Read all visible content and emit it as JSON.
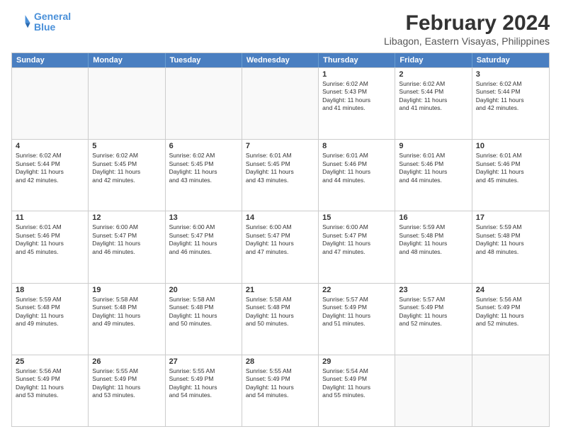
{
  "logo": {
    "line1": "General",
    "line2": "Blue"
  },
  "title": "February 2024",
  "subtitle": "Libagon, Eastern Visayas, Philippines",
  "header_days": [
    "Sunday",
    "Monday",
    "Tuesday",
    "Wednesday",
    "Thursday",
    "Friday",
    "Saturday"
  ],
  "rows": [
    [
      {
        "day": "",
        "info": ""
      },
      {
        "day": "",
        "info": ""
      },
      {
        "day": "",
        "info": ""
      },
      {
        "day": "",
        "info": ""
      },
      {
        "day": "1",
        "info": "Sunrise: 6:02 AM\nSunset: 5:43 PM\nDaylight: 11 hours\nand 41 minutes."
      },
      {
        "day": "2",
        "info": "Sunrise: 6:02 AM\nSunset: 5:44 PM\nDaylight: 11 hours\nand 41 minutes."
      },
      {
        "day": "3",
        "info": "Sunrise: 6:02 AM\nSunset: 5:44 PM\nDaylight: 11 hours\nand 42 minutes."
      }
    ],
    [
      {
        "day": "4",
        "info": "Sunrise: 6:02 AM\nSunset: 5:44 PM\nDaylight: 11 hours\nand 42 minutes."
      },
      {
        "day": "5",
        "info": "Sunrise: 6:02 AM\nSunset: 5:45 PM\nDaylight: 11 hours\nand 42 minutes."
      },
      {
        "day": "6",
        "info": "Sunrise: 6:02 AM\nSunset: 5:45 PM\nDaylight: 11 hours\nand 43 minutes."
      },
      {
        "day": "7",
        "info": "Sunrise: 6:01 AM\nSunset: 5:45 PM\nDaylight: 11 hours\nand 43 minutes."
      },
      {
        "day": "8",
        "info": "Sunrise: 6:01 AM\nSunset: 5:46 PM\nDaylight: 11 hours\nand 44 minutes."
      },
      {
        "day": "9",
        "info": "Sunrise: 6:01 AM\nSunset: 5:46 PM\nDaylight: 11 hours\nand 44 minutes."
      },
      {
        "day": "10",
        "info": "Sunrise: 6:01 AM\nSunset: 5:46 PM\nDaylight: 11 hours\nand 45 minutes."
      }
    ],
    [
      {
        "day": "11",
        "info": "Sunrise: 6:01 AM\nSunset: 5:46 PM\nDaylight: 11 hours\nand 45 minutes."
      },
      {
        "day": "12",
        "info": "Sunrise: 6:00 AM\nSunset: 5:47 PM\nDaylight: 11 hours\nand 46 minutes."
      },
      {
        "day": "13",
        "info": "Sunrise: 6:00 AM\nSunset: 5:47 PM\nDaylight: 11 hours\nand 46 minutes."
      },
      {
        "day": "14",
        "info": "Sunrise: 6:00 AM\nSunset: 5:47 PM\nDaylight: 11 hours\nand 47 minutes."
      },
      {
        "day": "15",
        "info": "Sunrise: 6:00 AM\nSunset: 5:47 PM\nDaylight: 11 hours\nand 47 minutes."
      },
      {
        "day": "16",
        "info": "Sunrise: 5:59 AM\nSunset: 5:48 PM\nDaylight: 11 hours\nand 48 minutes."
      },
      {
        "day": "17",
        "info": "Sunrise: 5:59 AM\nSunset: 5:48 PM\nDaylight: 11 hours\nand 48 minutes."
      }
    ],
    [
      {
        "day": "18",
        "info": "Sunrise: 5:59 AM\nSunset: 5:48 PM\nDaylight: 11 hours\nand 49 minutes."
      },
      {
        "day": "19",
        "info": "Sunrise: 5:58 AM\nSunset: 5:48 PM\nDaylight: 11 hours\nand 49 minutes."
      },
      {
        "day": "20",
        "info": "Sunrise: 5:58 AM\nSunset: 5:48 PM\nDaylight: 11 hours\nand 50 minutes."
      },
      {
        "day": "21",
        "info": "Sunrise: 5:58 AM\nSunset: 5:48 PM\nDaylight: 11 hours\nand 50 minutes."
      },
      {
        "day": "22",
        "info": "Sunrise: 5:57 AM\nSunset: 5:49 PM\nDaylight: 11 hours\nand 51 minutes."
      },
      {
        "day": "23",
        "info": "Sunrise: 5:57 AM\nSunset: 5:49 PM\nDaylight: 11 hours\nand 52 minutes."
      },
      {
        "day": "24",
        "info": "Sunrise: 5:56 AM\nSunset: 5:49 PM\nDaylight: 11 hours\nand 52 minutes."
      }
    ],
    [
      {
        "day": "25",
        "info": "Sunrise: 5:56 AM\nSunset: 5:49 PM\nDaylight: 11 hours\nand 53 minutes."
      },
      {
        "day": "26",
        "info": "Sunrise: 5:55 AM\nSunset: 5:49 PM\nDaylight: 11 hours\nand 53 minutes."
      },
      {
        "day": "27",
        "info": "Sunrise: 5:55 AM\nSunset: 5:49 PM\nDaylight: 11 hours\nand 54 minutes."
      },
      {
        "day": "28",
        "info": "Sunrise: 5:55 AM\nSunset: 5:49 PM\nDaylight: 11 hours\nand 54 minutes."
      },
      {
        "day": "29",
        "info": "Sunrise: 5:54 AM\nSunset: 5:49 PM\nDaylight: 11 hours\nand 55 minutes."
      },
      {
        "day": "",
        "info": ""
      },
      {
        "day": "",
        "info": ""
      }
    ]
  ]
}
